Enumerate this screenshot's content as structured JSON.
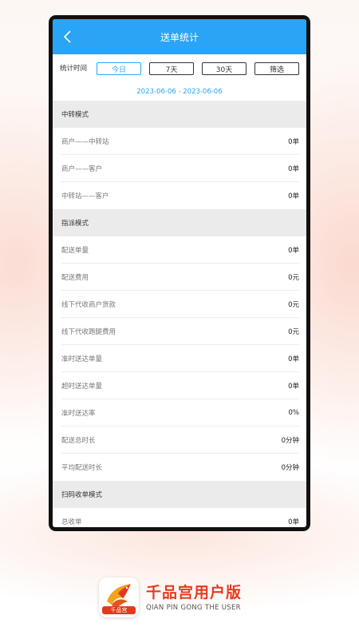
{
  "header": {
    "title": "送单统计"
  },
  "filter": {
    "label": "统计时间",
    "options": [
      "今日",
      "7天",
      "30天",
      "筛选"
    ],
    "selected": "今日"
  },
  "date_range": "2023-06-06 - 2023-06-06",
  "sections": [
    {
      "title": "中转模式",
      "rows": [
        {
          "label": "商户——中转站",
          "value": "0单"
        },
        {
          "label": "商户——客户",
          "value": "0单"
        },
        {
          "label": "中转站——客户",
          "value": "0单"
        }
      ]
    },
    {
      "title": "指派模式",
      "rows": [
        {
          "label": "配送单量",
          "value": "0单"
        },
        {
          "label": "配送费用",
          "value": "0元"
        },
        {
          "label": "线下代收商户货款",
          "value": "0元"
        },
        {
          "label": "线下代收跑腿费用",
          "value": "0元"
        },
        {
          "label": "准时送达单量",
          "value": "0单"
        },
        {
          "label": "超时送达单量",
          "value": "0单"
        },
        {
          "label": "准时送达率",
          "value": "0%"
        },
        {
          "label": "配送总时长",
          "value": "0分钟"
        },
        {
          "label": "平均配送时长",
          "value": "0分钟"
        }
      ]
    },
    {
      "title": "扫码收单模式",
      "rows": [
        {
          "label": "总收单",
          "value": "0单"
        }
      ]
    }
  ],
  "brand": {
    "name": "千品宫用户版",
    "subtitle": "QIAN PIN GONG THE USER",
    "icon_label": "千品宫"
  },
  "colors": {
    "accent": "#2aa4f4",
    "brand": "#e53b1f",
    "section_bg": "#ebebeb"
  },
  "icons": {
    "back": "chevron-left-icon",
    "app": "bird-logo-icon"
  }
}
